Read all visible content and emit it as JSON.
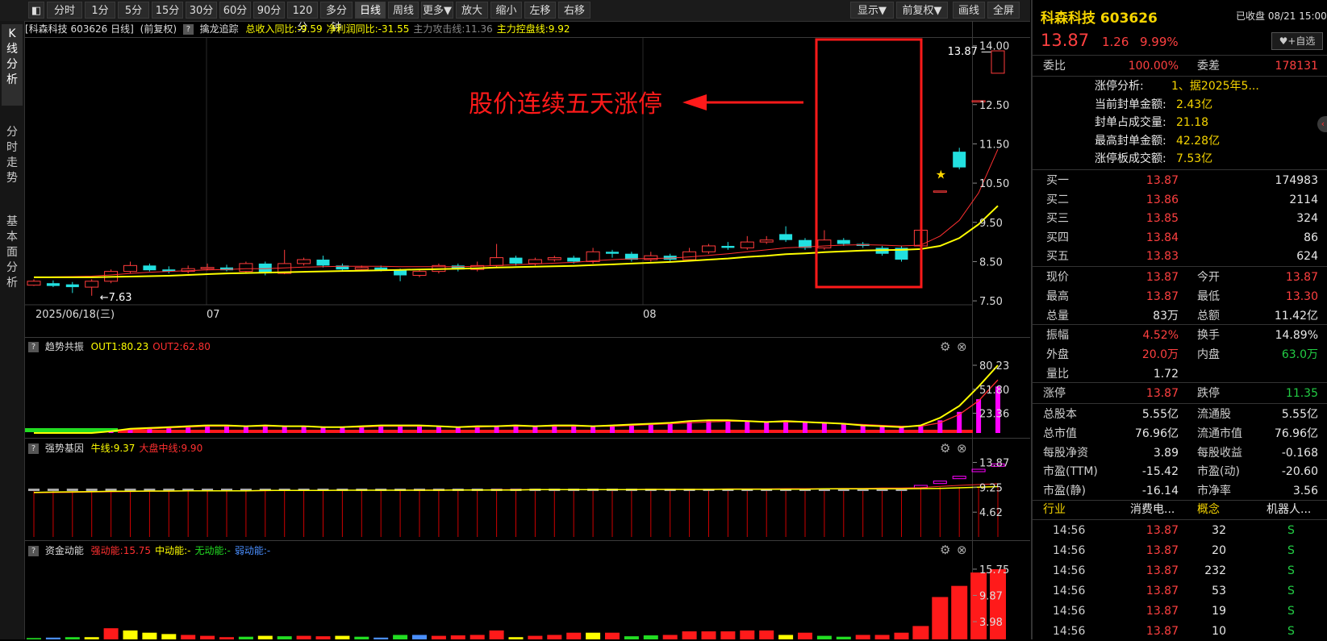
{
  "toolbar": {
    "buttons": [
      "分时",
      "1分",
      "5分",
      "15分",
      "30分",
      "60分",
      "90分",
      "120分",
      "多分钟",
      "日线",
      "周线",
      "更多▼",
      "放大",
      "缩小",
      "左移",
      "右移"
    ],
    "right_buttons": [
      "显示▼",
      "前复权▼",
      "画线",
      "全屏"
    ]
  },
  "side_tabs": [
    "K线分析",
    "分时走势",
    "基本面分析"
  ],
  "main_chart": {
    "header_title": "[科森科技 603626 日线]",
    "header_adj": "(前复权)",
    "indicator_name": "擒龙追踪",
    "indicator_items": [
      {
        "text": "总收入同比:-9.59",
        "color": "#ffff00"
      },
      {
        "text": "净利润同比:-31.55",
        "color": "#ffff00"
      },
      {
        "text": "主力攻击线:11.36",
        "color": "#888888"
      },
      {
        "text": "主力控盘线:9.92",
        "color": "#ffff00"
      }
    ],
    "y_ticks": [
      "14.00",
      "12.50",
      "11.50",
      "10.50",
      "9.50",
      "8.50",
      "7.50"
    ],
    "x_labels": [
      "2025/06/18(三)",
      "07",
      "08"
    ],
    "high_label": "13.87",
    "low_label": "7.63",
    "annotation": "股价连续五天涨停"
  },
  "chart_data": [
    {
      "type": "candlestick",
      "name": "日线",
      "candles": [
        [
          7.9,
          8.0,
          8.05,
          7.88
        ],
        [
          7.95,
          7.88,
          8.02,
          7.85
        ],
        [
          7.92,
          7.85,
          7.98,
          7.7
        ],
        [
          7.85,
          8.0,
          8.05,
          7.63
        ],
        [
          8.0,
          8.25,
          8.3,
          7.95
        ],
        [
          8.25,
          8.4,
          8.5,
          8.2
        ],
        [
          8.4,
          8.28,
          8.45,
          8.25
        ],
        [
          8.3,
          8.25,
          8.38,
          8.2
        ],
        [
          8.25,
          8.32,
          8.4,
          8.2
        ],
        [
          8.32,
          8.35,
          8.45,
          8.28
        ],
        [
          8.35,
          8.28,
          8.42,
          8.25
        ],
        [
          8.25,
          8.45,
          8.5,
          8.2
        ],
        [
          8.45,
          8.2,
          8.5,
          8.15
        ],
        [
          8.2,
          8.45,
          8.8,
          8.18
        ],
        [
          8.45,
          8.55,
          8.6,
          8.4
        ],
        [
          8.55,
          8.4,
          8.65,
          8.35
        ],
        [
          8.4,
          8.3,
          8.45,
          8.25
        ],
        [
          8.3,
          8.35,
          8.4,
          8.28
        ],
        [
          8.35,
          8.28,
          8.4,
          8.25
        ],
        [
          8.28,
          8.15,
          8.32,
          8.0
        ],
        [
          8.15,
          8.25,
          8.3,
          8.1
        ],
        [
          8.25,
          8.4,
          8.45,
          8.2
        ],
        [
          8.4,
          8.3,
          8.45,
          8.25
        ],
        [
          8.3,
          8.4,
          8.5,
          8.25
        ],
        [
          8.4,
          8.6,
          8.95,
          8.35
        ],
        [
          8.6,
          8.45,
          8.65,
          8.4
        ],
        [
          8.45,
          8.55,
          8.6,
          8.4
        ],
        [
          8.55,
          8.6,
          8.65,
          8.5
        ],
        [
          8.6,
          8.5,
          8.65,
          8.45
        ],
        [
          8.5,
          8.75,
          8.85,
          8.45
        ],
        [
          8.75,
          8.7,
          8.8,
          8.6
        ],
        [
          8.7,
          8.55,
          8.75,
          8.5
        ],
        [
          8.55,
          8.65,
          8.75,
          8.5
        ],
        [
          8.65,
          8.55,
          8.7,
          8.5
        ],
        [
          8.55,
          8.75,
          8.85,
          8.5
        ],
        [
          8.75,
          8.9,
          8.95,
          8.7
        ],
        [
          8.9,
          8.85,
          9.0,
          8.8
        ],
        [
          8.85,
          9.0,
          9.15,
          8.8
        ],
        [
          9.0,
          9.05,
          9.15,
          8.95
        ],
        [
          9.2,
          9.05,
          9.4,
          9.0
        ],
        [
          9.05,
          8.85,
          9.1,
          8.8
        ],
        [
          8.85,
          9.05,
          9.3,
          8.8
        ],
        [
          9.05,
          8.95,
          9.1,
          8.9
        ],
        [
          8.95,
          8.9,
          9.0,
          8.85
        ],
        [
          8.85,
          8.7,
          8.9,
          8.65
        ],
        [
          8.85,
          8.55,
          8.9,
          8.5
        ],
        [
          8.9,
          9.3,
          9.35,
          8.85
        ],
        [
          10.3,
          10.3,
          10.3,
          10.3
        ],
        [
          11.3,
          10.9,
          11.4,
          10.85
        ],
        [
          12.6,
          12.6,
          12.6,
          12.6
        ],
        [
          13.3,
          13.87,
          13.87,
          13.3
        ]
      ],
      "ma_fast": [
        8.1,
        8.11,
        8.12,
        8.13,
        8.16,
        8.2,
        8.23,
        8.25,
        8.27,
        8.29,
        8.3,
        8.32,
        8.32,
        8.34,
        8.36,
        8.37,
        8.38,
        8.38,
        8.38,
        8.37,
        8.37,
        8.37,
        8.37,
        8.38,
        8.4,
        8.42,
        8.44,
        8.46,
        8.48,
        8.52,
        8.55,
        8.57,
        8.58,
        8.59,
        8.62,
        8.66,
        8.7,
        8.75,
        8.8,
        8.85,
        8.87,
        8.9,
        8.92,
        8.93,
        8.92,
        8.9,
        8.92,
        9.15,
        9.55,
        10.25,
        11.36
      ],
      "ma_slow": [
        8.1,
        8.1,
        8.1,
        8.1,
        8.11,
        8.12,
        8.13,
        8.14,
        8.16,
        8.18,
        8.2,
        8.21,
        8.22,
        8.23,
        8.24,
        8.25,
        8.26,
        8.27,
        8.28,
        8.29,
        8.3,
        8.31,
        8.32,
        8.33,
        8.35,
        8.36,
        8.37,
        8.38,
        8.39,
        8.41,
        8.43,
        8.45,
        8.47,
        8.49,
        8.52,
        8.55,
        8.58,
        8.62,
        8.65,
        8.69,
        8.71,
        8.74,
        8.76,
        8.78,
        8.79,
        8.8,
        8.82,
        8.9,
        9.1,
        9.45,
        9.92
      ],
      "ylim": [
        7.4,
        14.2
      ]
    },
    {
      "type": "bar",
      "name": "趋势共振",
      "header_items": [
        {
          "text": "OUT1:80.23",
          "color": "#ffff00"
        },
        {
          "text": "OUT2:62.80",
          "color": "#ff3030"
        }
      ],
      "y_ticks": [
        "80.23",
        "51.80",
        "23.36"
      ],
      "values": [
        0,
        0,
        0,
        0,
        2,
        5,
        6,
        7,
        8,
        9,
        9,
        8,
        9,
        8,
        8,
        7,
        7,
        8,
        9,
        9,
        9,
        8,
        7,
        8,
        8,
        9,
        8,
        9,
        9,
        8,
        9,
        10,
        11,
        12,
        14,
        15,
        15,
        14,
        13,
        14,
        13,
        12,
        11,
        9,
        8,
        7,
        8,
        15,
        25,
        40,
        55
      ],
      "out1": [
        0,
        0,
        0,
        0,
        2,
        5,
        6,
        7,
        8,
        9,
        9,
        8,
        9,
        8,
        8,
        7,
        7,
        8,
        9,
        9,
        9,
        8,
        7,
        8,
        8,
        9,
        8,
        9,
        9,
        8,
        9,
        10,
        11,
        12,
        14,
        15,
        15,
        14,
        13,
        14,
        13,
        12,
        11,
        9,
        8,
        7,
        9,
        18,
        32,
        55,
        80.23
      ],
      "out2": [
        0,
        0,
        0,
        0,
        2,
        4,
        5,
        6,
        7,
        8,
        8,
        8,
        8,
        8,
        8,
        7,
        7,
        7,
        8,
        8,
        8,
        8,
        7,
        7,
        8,
        8,
        8,
        8,
        8,
        8,
        8,
        9,
        10,
        11,
        12,
        13,
        14,
        14,
        13,
        13,
        13,
        12,
        11,
        10,
        9,
        8,
        8,
        12,
        22,
        38,
        62.8
      ],
      "ylim": [
        0,
        85
      ]
    },
    {
      "type": "line",
      "name": "强势基因",
      "header_items": [
        {
          "text": "牛线:9.37",
          "color": "#ffff00"
        },
        {
          "text": "大盘中线:9.90",
          "color": "#ff3030"
        }
      ],
      "y_ticks": [
        "13.87",
        "9.25",
        "4.62"
      ],
      "bull_line": [
        8.3,
        8.35,
        8.4,
        8.45,
        8.5,
        8.5,
        8.55,
        8.55,
        8.6,
        8.6,
        8.6,
        8.6,
        8.65,
        8.65,
        8.65,
        8.65,
        8.7,
        8.7,
        8.7,
        8.7,
        8.7,
        8.7,
        8.75,
        8.75,
        8.75,
        8.75,
        8.8,
        8.8,
        8.8,
        8.8,
        8.8,
        8.8,
        8.85,
        8.85,
        8.85,
        8.85,
        8.9,
        8.9,
        8.9,
        8.9,
        8.9,
        8.95,
        8.95,
        8.95,
        8.95,
        8.95,
        9.0,
        9.05,
        9.15,
        9.25,
        9.37
      ],
      "mid_line": [
        8.2,
        8.25,
        8.3,
        8.35,
        8.4,
        8.45,
        8.5,
        8.5,
        8.55,
        8.55,
        8.6,
        8.6,
        8.6,
        8.65,
        8.65,
        8.65,
        8.7,
        8.7,
        8.7,
        8.7,
        8.75,
        8.75,
        8.75,
        8.75,
        8.8,
        8.8,
        8.8,
        8.8,
        8.85,
        8.85,
        8.85,
        8.85,
        8.9,
        8.9,
        8.9,
        8.9,
        8.95,
        8.95,
        8.95,
        9.0,
        9.0,
        9.0,
        9.05,
        9.05,
        9.1,
        9.1,
        9.2,
        9.4,
        9.6,
        9.75,
        9.9
      ],
      "ylim": [
        0,
        15
      ]
    },
    {
      "type": "bar",
      "name": "资金动能",
      "header_items": [
        {
          "text": "强动能:15.75",
          "color": "#ff3030"
        },
        {
          "text": "中动能:-",
          "color": "#ffff00"
        },
        {
          "text": "无动能:-",
          "color": "#22dd22"
        },
        {
          "text": "弱动能:-",
          "color": "#4a8fff"
        }
      ],
      "y_ticks": [
        "15.75",
        "9.87",
        "3.98"
      ],
      "values": [
        0.3,
        0.4,
        0.5,
        0.5,
        2.5,
        2.0,
        1.5,
        1.2,
        1.0,
        0.8,
        0.5,
        0.6,
        0.8,
        0.7,
        0.8,
        0.7,
        0.8,
        0.6,
        0.4,
        1.0,
        1.0,
        0.8,
        0.9,
        1.0,
        2.0,
        0.5,
        0.8,
        1.0,
        1.5,
        1.5,
        1.5,
        0.7,
        0.9,
        1.0,
        1.8,
        1.8,
        1.8,
        2.0,
        2.0,
        1.0,
        1.5,
        0.8,
        0.6,
        1.0,
        1.0,
        1.5,
        3.0,
        9.5,
        12.0,
        15.0,
        15.75
      ],
      "colors": [
        "#22dd22",
        "#4a8fff",
        "#22dd22",
        "#ffff00",
        "#ff1a1a",
        "#ffff00",
        "#ffff00",
        "#ffff00",
        "#ff1a1a",
        "#ff1a1a",
        "#ff1a1a",
        "#22dd22",
        "#ffff00",
        "#22dd22",
        "#ff1a1a",
        "#ff1a1a",
        "#ffff00",
        "#22dd22",
        "#4a8fff",
        "#22dd22",
        "#4a8fff",
        "#ff1a1a",
        "#ff1a1a",
        "#ff1a1a",
        "#ff1a1a",
        "#ffff00",
        "#ff1a1a",
        "#ff1a1a",
        "#ff1a1a",
        "#ffff00",
        "#ff1a1a",
        "#22dd22",
        "#22dd22",
        "#ff1a1a",
        "#ff1a1a",
        "#ff1a1a",
        "#ff1a1a",
        "#ff1a1a",
        "#ff1a1a",
        "#ffff00",
        "#ff1a1a",
        "#22dd22",
        "#22dd22",
        "#ff1a1a",
        "#ff1a1a",
        "#ff1a1a",
        "#ff1a1a",
        "#ff1a1a",
        "#ff1a1a",
        "#ff1a1a",
        "#ff1a1a"
      ],
      "ylim": [
        0,
        17
      ]
    }
  ],
  "stock": {
    "name": "科森科技 603626",
    "status": "已收盘 08/21 15:00",
    "price": "13.87",
    "change": "1.26",
    "pct": "9.99%",
    "watch_btn": "+自选",
    "weibi_label": "委比",
    "weibi": "100.00%",
    "weicha_label": "委差",
    "weicha": "178131",
    "limit_info": [
      {
        "label": "涨停分析:",
        "value": "1、据2025年5..."
      },
      {
        "label": "当前封单金额:",
        "value": "2.43亿"
      },
      {
        "label": "封单占成交量:",
        "value": "21.18"
      },
      {
        "label": "最高封单金额:",
        "value": "42.28亿"
      },
      {
        "label": "涨停板成交额:",
        "value": "7.53亿"
      }
    ],
    "bids": [
      {
        "label": "买一",
        "price": "13.87",
        "vol": "174983"
      },
      {
        "label": "买二",
        "price": "13.86",
        "vol": "2114"
      },
      {
        "label": "买三",
        "price": "13.85",
        "vol": "324"
      },
      {
        "label": "买四",
        "price": "13.84",
        "vol": "86"
      },
      {
        "label": "买五",
        "price": "13.83",
        "vol": "624"
      }
    ],
    "quote1": [
      {
        "l1": "现价",
        "v1": "13.87",
        "c1": "red",
        "l2": "今开",
        "v2": "13.87",
        "c2": "red"
      },
      {
        "l1": "最高",
        "v1": "13.87",
        "c1": "red",
        "l2": "最低",
        "v2": "13.30",
        "c2": "red"
      },
      {
        "l1": "总量",
        "v1": "83万",
        "c1": "wht",
        "l2": "总额",
        "v2": "11.42亿",
        "c2": "wht"
      }
    ],
    "quote2": [
      {
        "l1": "振幅",
        "v1": "4.52%",
        "c1": "red",
        "l2": "换手",
        "v2": "14.89%",
        "c2": "wht"
      },
      {
        "l1": "外盘",
        "v1": "20.0万",
        "c1": "red",
        "l2": "内盘",
        "v2": "63.0万",
        "c2": "grn"
      },
      {
        "l1": "量比",
        "v1": "1.72",
        "c1": "wht",
        "l2": "",
        "v2": "",
        "c2": "wht"
      }
    ],
    "limits": {
      "up_label": "涨停",
      "up": "13.87",
      "down_label": "跌停",
      "down": "11.35"
    },
    "fundamentals": [
      {
        "l1": "总股本",
        "v1": "5.55亿",
        "l2": "流通股",
        "v2": "5.55亿"
      },
      {
        "l1": "总市值",
        "v1": "76.96亿",
        "l2": "流通市值",
        "v2": "76.96亿"
      },
      {
        "l1": "每股净资",
        "v1": "3.89",
        "l2": "每股收益",
        "v2": "-0.168"
      },
      {
        "l1": "市盈(TTM)",
        "v1": "-15.42",
        "l2": "市盈(动)",
        "v2": "-20.60"
      },
      {
        "l1": "市盈(静)",
        "v1": "-16.14",
        "l2": "市净率",
        "v2": "3.56"
      }
    ],
    "industry_label": "行业",
    "industry": "消费电...",
    "concept_label": "概念",
    "concept": "机器人...",
    "ticks": [
      {
        "time": "14:56",
        "price": "13.87",
        "vol": "32",
        "side": "S"
      },
      {
        "time": "14:56",
        "price": "13.87",
        "vol": "20",
        "side": "S"
      },
      {
        "time": "14:56",
        "price": "13.87",
        "vol": "232",
        "side": "S"
      },
      {
        "time": "14:56",
        "price": "13.87",
        "vol": "53",
        "side": "S"
      },
      {
        "time": "14:56",
        "price": "13.87",
        "vol": "19",
        "side": "S"
      },
      {
        "time": "14:56",
        "price": "13.87",
        "vol": "10",
        "side": "S"
      }
    ]
  }
}
